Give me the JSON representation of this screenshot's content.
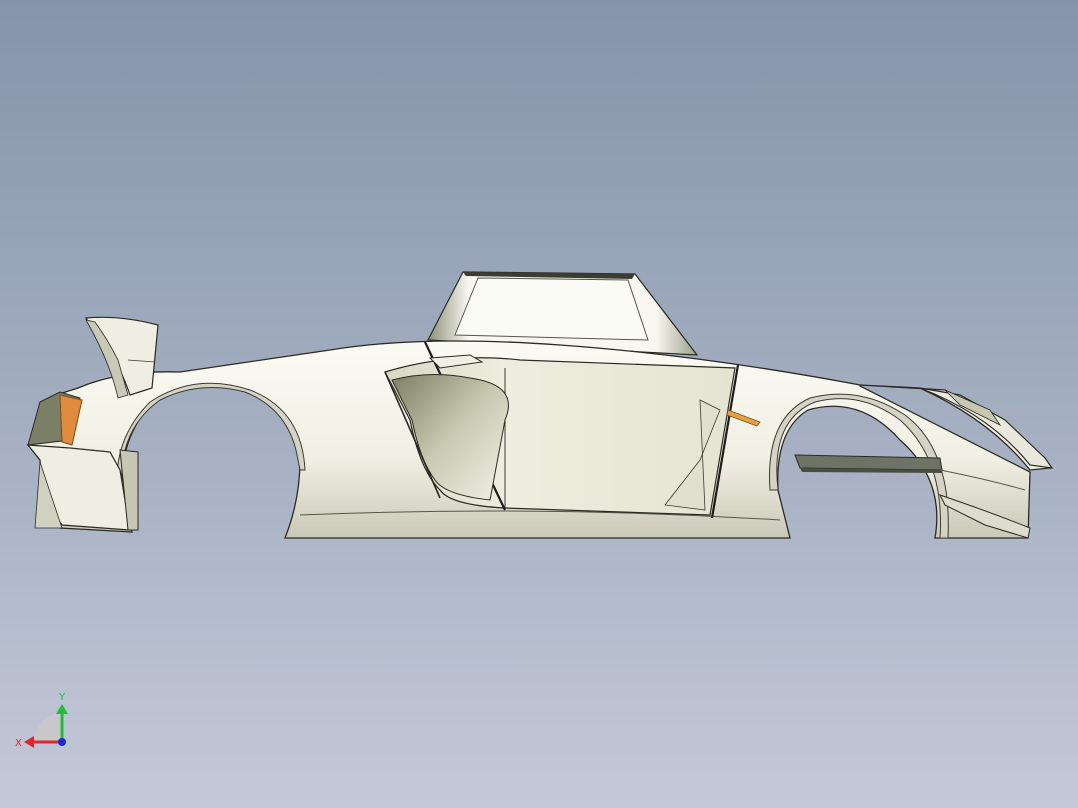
{
  "viewport": {
    "background_top": "#8594ab",
    "background_bottom": "#c4c9d8"
  },
  "model": {
    "body_color": "#f4f3ea",
    "shade_color": "#cfcebf",
    "edge_color": "#2a2a22",
    "accent_color": "#e08a3c",
    "underside_color": "#6f7366"
  },
  "triad": {
    "x_label": "X",
    "y_label": "Y",
    "x_color": "#e0262e",
    "y_color": "#1fbf3a",
    "z_color": "#1a2bd6"
  }
}
